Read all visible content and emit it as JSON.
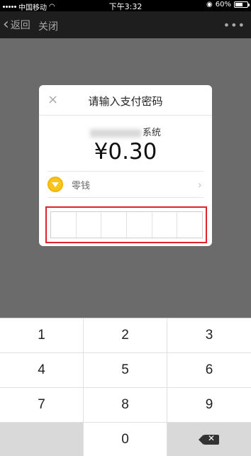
{
  "status_bar": {
    "carrier": "中国移动",
    "time": "下午3:32",
    "battery": "60%",
    "battery_level": 0.6
  },
  "nav": {
    "back_label": "返回",
    "close_label": "关闭",
    "more_icon": "more-dots-icon"
  },
  "dialog": {
    "close_icon": "×",
    "title": "请输入支付密码",
    "merchant_suffix": "系统",
    "amount": "¥0.30",
    "payment_method": {
      "icon": "coin-icon",
      "label": "零钱",
      "chevron": "›"
    },
    "password_length": 6
  },
  "keypad": {
    "keys": [
      "1",
      "2",
      "3",
      "4",
      "5",
      "6",
      "7",
      "8",
      "9",
      "",
      "0",
      "delete"
    ],
    "delete_glyph": "✕"
  },
  "colors": {
    "highlight_border": "#e0242a",
    "nav_bg": "#1e1e1e",
    "overlay": "#6b6b6b"
  }
}
